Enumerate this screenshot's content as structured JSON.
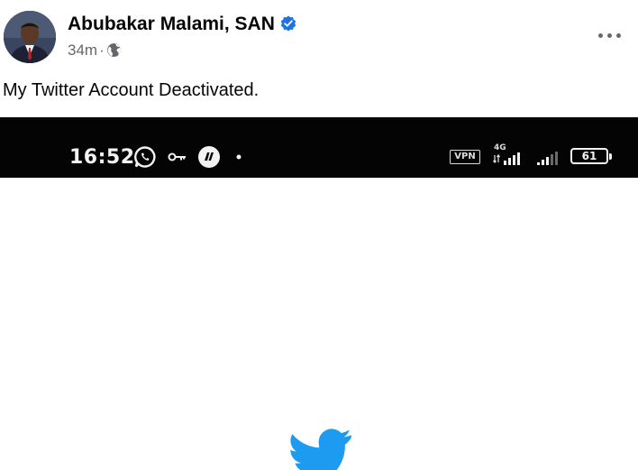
{
  "post": {
    "author_name": "Abubakar Malami, SAN",
    "timestamp": "34m",
    "separator": "·",
    "audience_icon": "globe-icon",
    "verified_icon": "verified-badge-icon",
    "more_icon": "more-options-icon",
    "caption": "My Twitter Account Deactivated."
  },
  "screenshot": {
    "status_bar": {
      "time": "16:52",
      "vpn_label": "VPN",
      "network_label": "4G",
      "battery_level": "61",
      "icons": [
        "whatsapp-icon",
        "key-icon",
        "app-notification-icon",
        "dot-icon",
        "vpn-icon",
        "signal-icon",
        "signal-icon",
        "battery-icon"
      ]
    },
    "logo_icon": "twitter-bird-icon"
  },
  "colors": {
    "verified_blue": "#1b74e4",
    "twitter_blue": "#1d9bf0",
    "meta_gray": "#65676b",
    "status_bar_bg": "#040404"
  }
}
